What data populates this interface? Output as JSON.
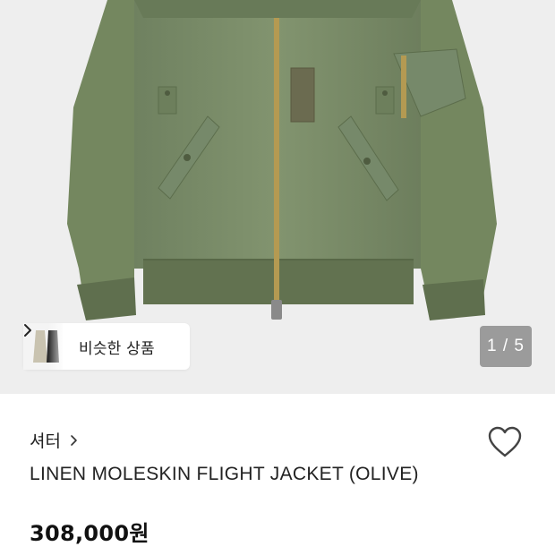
{
  "product_image": {
    "description_icon": "olive-flight-jacket-photo"
  },
  "similar_products": {
    "label": "비슷한 상품",
    "chevron_icon": "chevron-right-icon"
  },
  "gallery": {
    "counter": "1 / 5"
  },
  "brand": {
    "name": "셔터",
    "chevron_icon": "chevron-right-icon"
  },
  "wishlist": {
    "icon": "heart-outline-icon"
  },
  "product": {
    "name": "LINEN MOLESKIN FLIGHT JACKET (OLIVE)",
    "price": "308,000원"
  },
  "colors": {
    "image_background": "#eeeeee",
    "jacket_olive": "#7d8f6a",
    "counter_background": "#8c8c8c"
  }
}
